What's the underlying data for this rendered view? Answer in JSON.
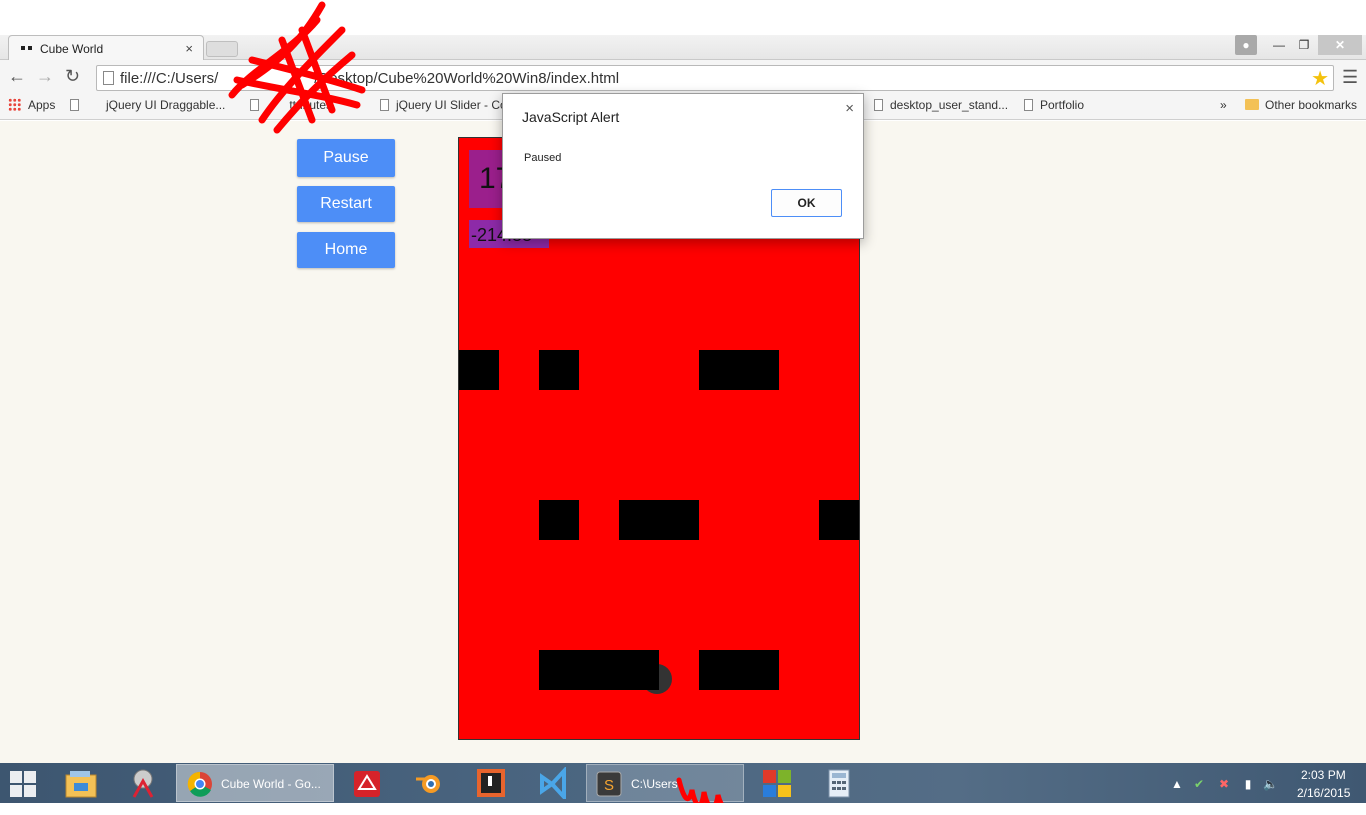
{
  "browser": {
    "tab_title": "Cube World",
    "tab_close": "×",
    "url": "file:///C:/Users/                       /Desktop/Cube%20World%20Win8/index.html",
    "bookmarks": [
      "Apps",
      "jQuery UI Draggable...",
      "       ttributes",
      "jQuery UI Slider - Co",
      "desktop_user_stand...",
      "Portfolio"
    ],
    "overflow": "»",
    "other_bookmarks": "Other bookmarks"
  },
  "game": {
    "buttons": {
      "pause": "Pause",
      "restart": "Restart",
      "home": "Home"
    },
    "score": "17",
    "offset": "-214.88"
  },
  "alert": {
    "title": "JavaScript Alert",
    "message": "Paused",
    "ok": "OK",
    "close": "×"
  },
  "taskbar": {
    "chrome_label": "Cube World - Go...",
    "explorer_label": "C:\\Users\\",
    "time": "2:03 PM",
    "date": "2/16/2015"
  },
  "icons": {
    "back": "back-arrow-icon",
    "forward": "forward-arrow-icon",
    "reload": "reload-icon",
    "star": "bookmark-star-icon",
    "menu": "hamburger-menu-icon"
  },
  "colors": {
    "game_bg": "#ff0000",
    "score_bg": "#9b1f8c",
    "button_blue": "#4d8ef7",
    "page_bg": "#f9f7f0"
  }
}
